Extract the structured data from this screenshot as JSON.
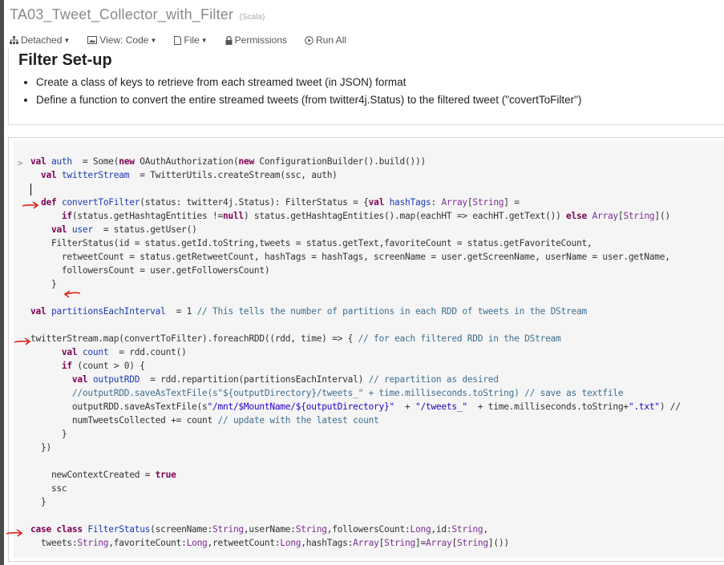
{
  "notebook": {
    "title": "TA03_Tweet_Collector_with_Filter",
    "language": "(Scala)"
  },
  "toolbar": {
    "detached": "Detached",
    "view": "View: Code",
    "file": "File",
    "permissions": "Permissions",
    "run_all": "Run All"
  },
  "markdown_cell": {
    "heading": "Filter Set-up",
    "bullets": [
      "Create a class of keys to retrieve from each streamed tweet (in JSON) format",
      "Define a function to convert the entire streamed tweets (from twitter4j.Status) to the filtered tweet (\"covertToFilter\")"
    ]
  },
  "code_cell": {
    "prompt": ">",
    "lines": [
      [
        [
          "kw",
          "val "
        ],
        [
          "vn",
          "auth"
        ],
        [
          "",
          "  = Some("
        ],
        [
          "kw",
          "new "
        ],
        [
          "",
          "OAuthAuthorization("
        ],
        [
          "kw",
          "new "
        ],
        [
          "",
          "ConfigurationBuilder().build()))"
        ]
      ],
      [
        [
          "",
          "  "
        ],
        [
          "kw",
          "val "
        ],
        [
          "vn",
          "twitterStream"
        ],
        [
          "",
          "  = TwitterUtils.createStream(ssc, auth)"
        ]
      ],
      [
        [
          "",
          ""
        ]
      ],
      [
        [
          "",
          "  "
        ],
        [
          "kw",
          "def "
        ],
        [
          "vn",
          "convertToFilter"
        ],
        [
          "",
          "(status: twitter4j.Status): FilterStatus = {"
        ],
        [
          "kw",
          "val "
        ],
        [
          "vn",
          "hashTags"
        ],
        [
          "",
          ": "
        ],
        [
          "ty",
          "Array"
        ],
        [
          "",
          "["
        ],
        [
          "ty",
          "String"
        ],
        [
          "",
          "] ="
        ]
      ],
      [
        [
          "",
          "      "
        ],
        [
          "kw",
          "if"
        ],
        [
          "",
          "(status.getHashtagEntities !="
        ],
        [
          "kw",
          "null"
        ],
        [
          "",
          ") status.getHashtagEntities().map(eachHT => eachHT.getText()) "
        ],
        [
          "kw",
          "else "
        ],
        [
          "ty",
          "Array"
        ],
        [
          "",
          "["
        ],
        [
          "ty",
          "String"
        ],
        [
          "",
          "]()"
        ]
      ],
      [
        [
          "",
          "    "
        ],
        [
          "kw",
          "val "
        ],
        [
          "vn",
          "user"
        ],
        [
          "",
          "  = status.getUser()"
        ]
      ],
      [
        [
          "",
          "    FilterStatus(id = status.getId.toString,tweets = status.getText,favoriteCount = status.getFavoriteCount,"
        ]
      ],
      [
        [
          "",
          "      retweetCount = status.getRetweetCount, hashTags = hashTags, screenName = user.getScreenName, userName = user.getName,"
        ]
      ],
      [
        [
          "",
          "      followersCount = user.getFollowersCount)"
        ]
      ],
      [
        [
          "",
          "    }"
        ]
      ],
      [
        [
          "",
          ""
        ]
      ],
      [
        [
          "",
          ""
        ],
        [
          "kw",
          "val "
        ],
        [
          "vn",
          "partitionsEachInterval"
        ],
        [
          "",
          "  = 1 "
        ],
        [
          "cm",
          "// This tells the number of partitions in each RDD of tweets in the DStream"
        ]
      ],
      [
        [
          "",
          ""
        ]
      ],
      [
        [
          "",
          "twitterStream.map(convertToFilter).foreachRDD((rdd, time) => { "
        ],
        [
          "cm",
          "// for each filtered RDD in the DStream"
        ]
      ],
      [
        [
          "",
          "      "
        ],
        [
          "kw",
          "val "
        ],
        [
          "vn",
          "count"
        ],
        [
          "",
          "  = rdd.count()"
        ]
      ],
      [
        [
          "",
          "      "
        ],
        [
          "kw",
          "if "
        ],
        [
          "",
          "(count > 0) {"
        ]
      ],
      [
        [
          "",
          "        "
        ],
        [
          "kw",
          "val "
        ],
        [
          "vn",
          "outputRDD"
        ],
        [
          "",
          "  = rdd.repartition(partitionsEachInterval) "
        ],
        [
          "cm",
          "// repartition as desired"
        ]
      ],
      [
        [
          "",
          "        "
        ],
        [
          "cm",
          "//outputRDD.saveAsTextFile(s\"${outputDirectory}/tweets_\" + time.milliseconds.toString) // save as textfile"
        ]
      ],
      [
        [
          "",
          "        outputRDD.saveAsTextFile(s"
        ],
        [
          "st",
          "\"/mnt/$MountName/${outputDirectory}\""
        ],
        [
          "",
          "  + "
        ],
        [
          "st",
          "\"/tweets_\""
        ],
        [
          "",
          "  + time.milliseconds.toString+"
        ],
        [
          "st",
          "\".txt\""
        ],
        [
          "",
          ") //"
        ]
      ],
      [
        [
          "",
          "        numTweetsCollected += count "
        ],
        [
          "cm",
          "// update with the latest count"
        ]
      ],
      [
        [
          "",
          "      }"
        ]
      ],
      [
        [
          "",
          "  })"
        ]
      ],
      [
        [
          "",
          ""
        ]
      ],
      [
        [
          "",
          "    newContextCreated = "
        ],
        [
          "kw",
          "true"
        ]
      ],
      [
        [
          "",
          "    ssc"
        ]
      ],
      [
        [
          "",
          "  }"
        ]
      ],
      [
        [
          "",
          ""
        ]
      ],
      [
        [
          "",
          ""
        ],
        [
          "kw",
          "case class "
        ],
        [
          "vn",
          "FilterStatus"
        ],
        [
          "",
          "(screenName:"
        ],
        [
          "ty",
          "String"
        ],
        [
          "",
          ",userName:"
        ],
        [
          "ty",
          "String"
        ],
        [
          "",
          ",followersCount:"
        ],
        [
          "ty",
          "Long"
        ],
        [
          "",
          ",id:"
        ],
        [
          "ty",
          "String"
        ],
        [
          "",
          ","
        ]
      ],
      [
        [
          "",
          "  tweets:"
        ],
        [
          "ty",
          "String"
        ],
        [
          "",
          ",favoriteCount:"
        ],
        [
          "ty",
          "Long"
        ],
        [
          "",
          ",retweetCount:"
        ],
        [
          "ty",
          "Long"
        ],
        [
          "",
          ",hashTags:"
        ],
        [
          "ty",
          "Array"
        ],
        [
          "",
          "["
        ],
        [
          "ty",
          "String"
        ],
        [
          "",
          "]="
        ],
        [
          "ty",
          "Array"
        ],
        [
          "",
          "["
        ],
        [
          "ty",
          "String"
        ],
        [
          "",
          "]())"
        ]
      ]
    ]
  },
  "colors": {
    "keyword": "#7f0055",
    "variable": "#1a3cb5",
    "type": "#7b2f92",
    "comment": "#3f6f8f",
    "annotation_arrow": "#e0201a"
  },
  "icons": [
    "sitemap-icon",
    "image-icon",
    "file-icon",
    "lock-icon",
    "play-circle-icon",
    "red-arrow-icon"
  ]
}
